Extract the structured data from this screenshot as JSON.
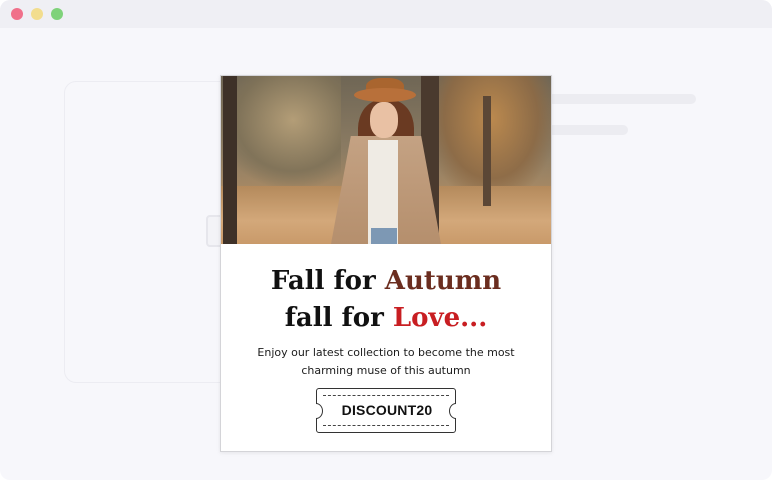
{
  "window": {
    "controls": [
      "close",
      "minimize",
      "maximize"
    ],
    "colors": {
      "close": "#f0708a",
      "minimize": "#f2dd8e",
      "maximize": "#7fd27a"
    }
  },
  "background": {
    "image_icon": "image-placeholder-icon"
  },
  "popup": {
    "hero_image": "woman-in-autumn-park-photo",
    "headline_line1_start": "Fall for ",
    "headline_line1_accent": "Autumn",
    "headline_line2_start": "fall for ",
    "headline_line2_accent": "Love...",
    "accent_colors": {
      "autumn": "#6b2d1f",
      "love": "#c81e22"
    },
    "subtext_line1": "Enjoy our latest collection to become the most",
    "subtext_line2": "charming muse of this autumn",
    "coupon_code": "DISCOUNT20"
  }
}
